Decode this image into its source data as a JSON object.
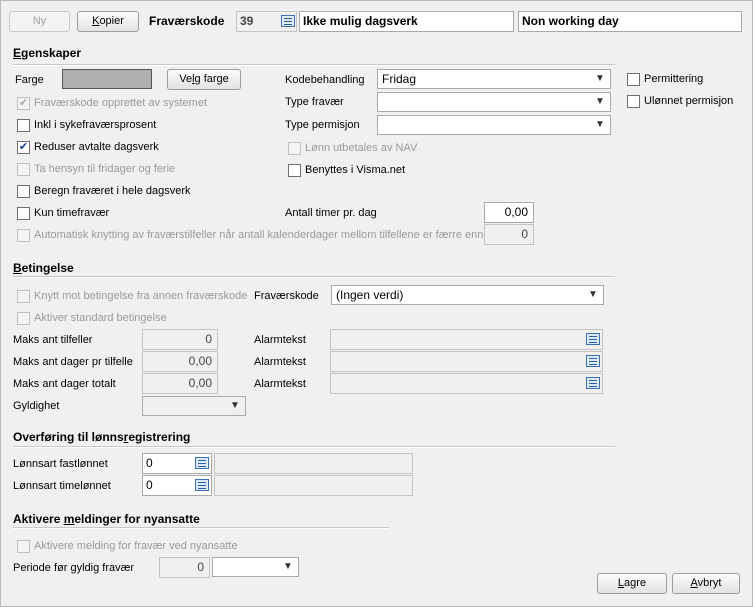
{
  "toolbar": {
    "new_label": "Ny",
    "copy_label": "Kopier",
    "code_label": "Fraværskode",
    "code_value": "39",
    "name_value": "Ikke mulig dagsverk",
    "name_en_value": "Non working day"
  },
  "properties": {
    "heading": "Egenskaper",
    "color_label": "Farge",
    "color_value": "#b0b0b0",
    "choose_color_label": "Velg farge",
    "code_handling_label": "Kodebehandling",
    "code_handling_value": "Fridag",
    "absence_type_label": "Type fravær",
    "absence_type_value": "",
    "leave_type_label": "Type permisjon",
    "leave_type_value": "",
    "layoff_label": "Permittering",
    "unpaid_leave_label": "Ulønnet permisjon",
    "system_created_label": "Fraværskode opprettet av systemet",
    "sick_percent_label": "Inkl i sykefraværsprosent",
    "reduce_agreed_label": "Reduser avtalte dagsverk",
    "holidays_label": "Ta hensyn til fridager og ferie",
    "whole_day_label": "Beregn fraværet i hele dagsverk",
    "nav_pay_label": "Lønn utbetales av NAV",
    "visma_label": "Benyttes i Visma.net",
    "hourly_only_label": "Kun timefravær",
    "hours_per_day_label": "Antall timer pr. dag",
    "hours_per_day_value": "0,00",
    "auto_link_label": "Automatisk knytting av fraværstilfeller når antall kalenderdager mellom tilfellene er færre enn",
    "auto_link_value": "0"
  },
  "condition": {
    "heading": "Betingelse",
    "link_label": "Knytt mot betingelse fra annen fraværskode",
    "code_label": "Fraværskode",
    "code_value": "(Ingen verdi)",
    "standard_label": "Aktiver standard betingelse",
    "max_cases_label": "Maks ant tilfeller",
    "max_cases_value": "0",
    "max_days_case_label": "Maks ant dager pr tilfelle",
    "max_days_case_value": "0,00",
    "max_days_total_label": "Maks ant dager totalt",
    "max_days_total_value": "0,00",
    "alarm_label": "Alarmtekst",
    "validity_label": "Gyldighet"
  },
  "payroll": {
    "heading": "Overføring til lønnsregistrering",
    "fixed_label": "Lønnsart fastlønnet",
    "fixed_value": "0",
    "hourly_label": "Lønnsart timelønnet",
    "hourly_value": "0"
  },
  "notify": {
    "heading": "Aktivere meldinger for nyansatte",
    "enable_label": "Aktivere melding for fravær ved nyansatte",
    "period_label": "Periode før gyldig fravær",
    "period_value": "0"
  },
  "footer": {
    "save_label": "Lagre",
    "cancel_label": "Avbryt"
  },
  "icons": [
    "lookup-icon",
    "checkmark-icon",
    "chevron-down-icon"
  ]
}
